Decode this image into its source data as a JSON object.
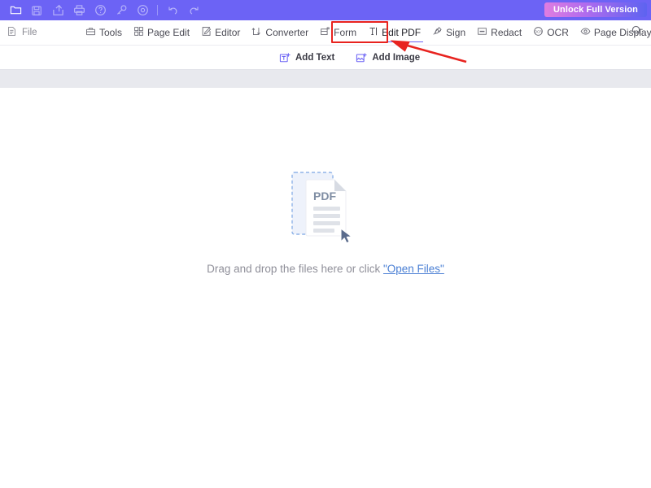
{
  "titlebar": {
    "quick_icons": [
      {
        "name": "open-folder-icon",
        "label": "Open"
      },
      {
        "name": "save-icon",
        "label": "Save"
      },
      {
        "name": "share-export-icon",
        "label": "Share"
      },
      {
        "name": "print-icon",
        "label": "Print"
      },
      {
        "name": "help-icon",
        "label": "Help"
      },
      {
        "name": "key-icon",
        "label": "License Key"
      },
      {
        "name": "record-target-icon",
        "label": "Record"
      },
      {
        "name": "undo-icon",
        "label": "Undo"
      },
      {
        "name": "redo-icon",
        "label": "Redo"
      }
    ],
    "unlock_label": "Unlock Full Version",
    "bar_color": "#6c63f5",
    "unlock_gradient_from": "#e07de0",
    "unlock_gradient_to": "#5d63f0"
  },
  "menubar": {
    "file_label": "File",
    "items": [
      {
        "label": "Tools",
        "icon": "toolbox-icon",
        "selected": false
      },
      {
        "label": "Page Edit",
        "icon": "grid-pages-icon",
        "selected": false
      },
      {
        "label": "Editor",
        "icon": "pencil-square-icon",
        "selected": false
      },
      {
        "label": "Converter",
        "icon": "convert-arrows-icon",
        "selected": false
      },
      {
        "label": "Form",
        "icon": "form-frame-icon",
        "selected": false
      },
      {
        "label": "Edit PDF",
        "icon": "text-cursor-icon",
        "selected": true
      },
      {
        "label": "Sign",
        "icon": "signature-pen-icon",
        "selected": false
      },
      {
        "label": "Redact",
        "icon": "redact-bar-icon",
        "selected": false
      },
      {
        "label": "OCR",
        "icon": "ocr-circle-icon",
        "selected": false
      },
      {
        "label": "Page Display",
        "icon": "eye-icon",
        "selected": false
      }
    ],
    "search_icon": "search-dropdown-icon",
    "selected_underline_color": "#6c63f5",
    "highlight_box_color": "#e8231f"
  },
  "subbar": {
    "items": [
      {
        "label": "Add Text",
        "icon": "add-text-icon"
      },
      {
        "label": "Add Image",
        "icon": "add-image-icon"
      }
    ],
    "icon_color": "#6c63f5"
  },
  "content": {
    "pdf_badge_text": "PDF",
    "drop_text_prefix": "Drag and drop the files here or click ",
    "open_files_label": "\"Open Files\"",
    "link_color": "#4a7fd4"
  },
  "annotation": {
    "arrow_color": "#e8231f",
    "arrow_points_to": "Edit PDF"
  }
}
